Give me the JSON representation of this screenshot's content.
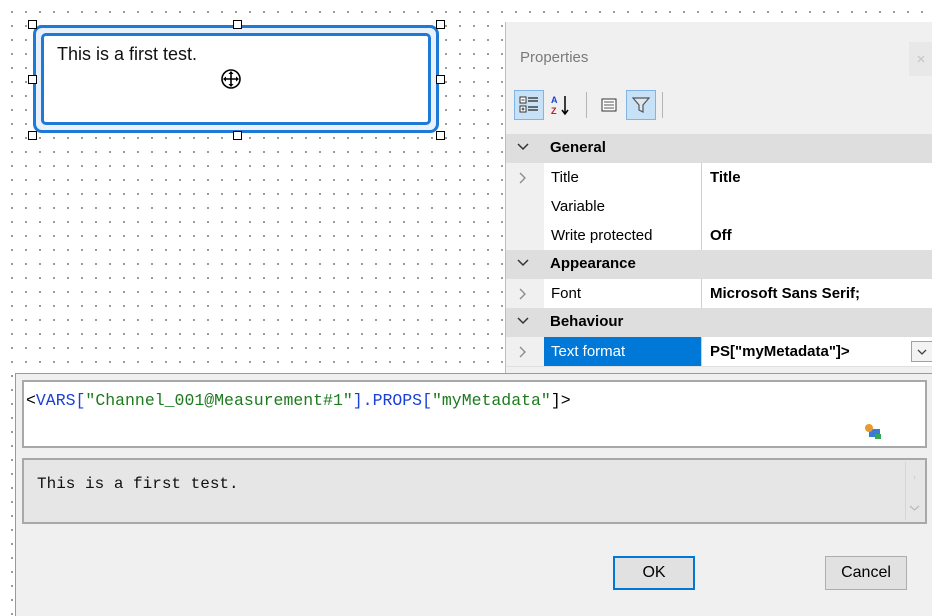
{
  "canvas": {
    "textbox_text": "This is a first test."
  },
  "properties_panel": {
    "title": "Properties",
    "close_label": "x",
    "categories": {
      "general": "General",
      "appearance": "Appearance",
      "behaviour": "Behaviour"
    },
    "rows": {
      "title": {
        "name": "Title",
        "value": "Title"
      },
      "variable": {
        "name": "Variable",
        "value": ""
      },
      "write_protected": {
        "name": "Write protected",
        "value": "Off"
      },
      "font": {
        "name": "Font",
        "value": "Microsoft Sans Serif;"
      },
      "text_format": {
        "name": "Text format",
        "value": "PS[\"myMetadata\"]>"
      }
    },
    "toolbar_icons": [
      "categorized-icon",
      "alphabetical-sort-icon",
      "property-pages-icon",
      "filter-icon"
    ]
  },
  "dialog": {
    "expression": {
      "part1": "<",
      "part2": "VARS[",
      "part3": "\"Channel_001@Measurement#1\"",
      "part4": "].PROPS[",
      "part5": "\"myMetadata\"",
      "part6": "]>"
    },
    "result_text": "This is a first test.",
    "ok_label": "OK",
    "cancel_label": "Cancel"
  },
  "colors": {
    "selection_accent": "#1f79d6",
    "selected_row": "#0078d7",
    "keyword_blue": "#1a3fd6",
    "string_green": "#1d7a1d"
  }
}
